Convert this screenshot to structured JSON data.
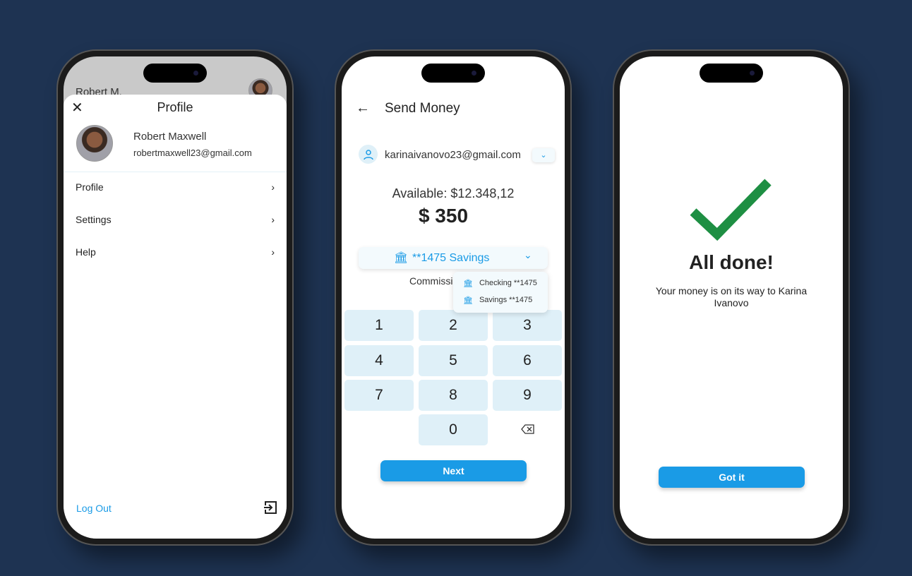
{
  "profile_screen": {
    "header_name": "Robert M.",
    "title": "Profile",
    "user_name": "Robert Maxwell",
    "user_email": "robertmaxwell23@gmail.com",
    "menu_items": [
      {
        "label": "Profile"
      },
      {
        "label": "Settings"
      },
      {
        "label": "Help"
      }
    ],
    "logout_label": "Log Out"
  },
  "send_screen": {
    "title": "Send Money",
    "recipient_email": "karinaivanovo23@gmail.com",
    "available": "Available: $12.348,12",
    "amount": "$ 350",
    "selected_account": "**1475 Savings",
    "commission": "Commission",
    "account_options": [
      {
        "label": "Checking **1475"
      },
      {
        "label": "Savings **1475"
      }
    ],
    "keys": [
      "1",
      "2",
      "3",
      "4",
      "5",
      "6",
      "7",
      "8",
      "9",
      "0"
    ],
    "next_label": "Next"
  },
  "done_screen": {
    "title": "All done!",
    "message": "Your money is on its way to Karina Ivanovo",
    "button_label": "Got it"
  },
  "colors": {
    "accent": "#1a9be6",
    "success": "#1e8f43",
    "background": "#1e3352",
    "keypad": "#dff0f8"
  }
}
